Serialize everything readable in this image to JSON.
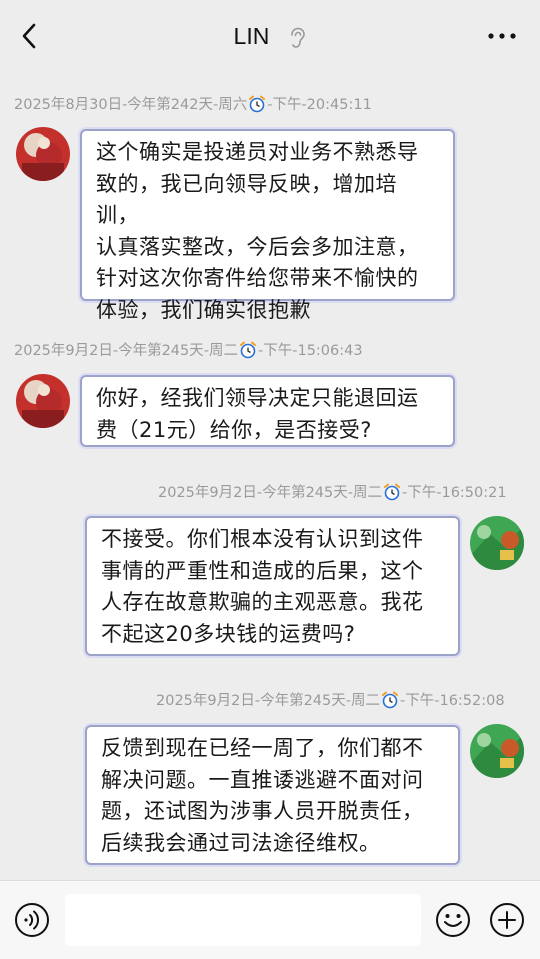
{
  "header": {
    "title": "LIN"
  },
  "messages": [
    {
      "timestamp_date": "2025年8月30日-今年第242天-周六",
      "timestamp_time": "-下午-20:45:11",
      "side": "left",
      "text": "这个确实是投递员对业务不熟悉导致的，我已向领导反映，增加培训，认真落实整改，今后会多加注意，针对这次你寄件给您带来不愉快的体验，我们确实很抱歉"
    },
    {
      "timestamp_date": "2025年9月2日-今年第245天-周二",
      "timestamp_time": "-下午-15:06:43",
      "side": "left",
      "text": "你好，经我们领导决定只能退回运费（21元）给你，是否接受?"
    },
    {
      "timestamp_date": "2025年9月2日-今年第245天-周二",
      "timestamp_time": "-下午-16:50:21",
      "side": "right",
      "text": "不接受。你们根本没有认识到这件事情的严重性和造成的后果，这个人存在故意欺骗的主观恶意。我花不起这20多块钱的运费吗?"
    },
    {
      "timestamp_date": "2025年9月2日-今年第245天-周二",
      "timestamp_time": "-下午-16:52:08",
      "side": "right",
      "text": "反馈到现在已经一周了，你们都不解决问题。一直推诿逃避不面对问题，还试图为涉事人员开脱责任，后续我会通过司法途径维权。"
    }
  ],
  "bubble_lines": [
    [
      "这个确实是投递员对业务不熟悉导",
      "致的，我已向领导反映，增加培训，",
      "认真落实整改，今后会多加注意，",
      "针对这次你寄件给您带来不愉快的",
      "体验，我们确实很抱歉"
    ],
    [
      "你好，经我们领导决定只能退回运",
      "费（21元）给你，是否接受?"
    ],
    [
      "不接受。你们根本没有认识到这件",
      "事情的严重性和造成的后果，这个",
      "人存在故意欺骗的主观恶意。我花",
      "不起这20多块钱的运费吗?"
    ],
    [
      "反馈到现在已经一周了，你们都不",
      "解决问题。一直推诿逃避不面对问",
      "题，还试图为涉事人员开脱责任，",
      "后续我会通过司法途径维权。"
    ]
  ],
  "icons": {
    "back": "chevron-left-icon",
    "mute": "ear-icon",
    "more": "more-dots-icon",
    "clock": "alarm-clock-icon",
    "voice": "voice-icon",
    "emoji": "emoji-icon",
    "plus": "plus-icon"
  },
  "colors": {
    "background": "#ededed",
    "bubble_border": "#9da2c9",
    "timestamp": "#9a9a9a"
  }
}
